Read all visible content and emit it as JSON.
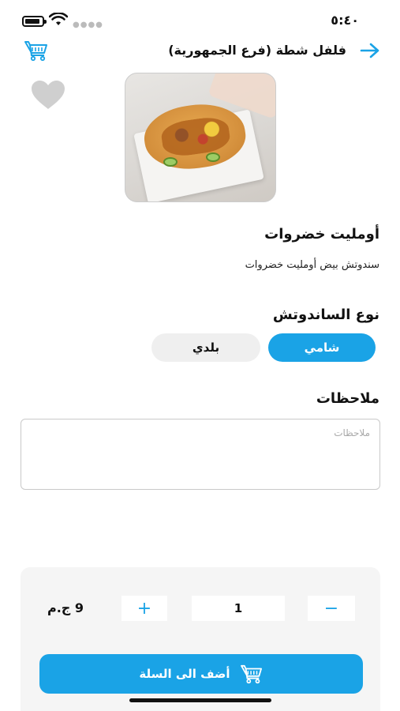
{
  "status_bar": {
    "time": "٥:٤٠"
  },
  "header": {
    "title": "فلفل شطة (فرع الجمهورية)"
  },
  "product": {
    "name": "أومليت خضروات",
    "description": "سندوتش بيض أومليت خضروات"
  },
  "sandwich_type": {
    "title": "نوع الساندوتش",
    "options": [
      {
        "label": "شامي",
        "selected": true
      },
      {
        "label": "بلدي",
        "selected": false
      }
    ]
  },
  "notes": {
    "title": "ملاحظات",
    "placeholder": "ملاحظات",
    "value": ""
  },
  "cart_panel": {
    "price": "9 ج.م",
    "quantity": "1",
    "plus_label": "+",
    "minus_label": "−",
    "add_button_label": "أضف الى السلة"
  },
  "colors": {
    "accent": "#1aa3e6",
    "option_unselected_bg": "#efefef",
    "panel_bg": "#f5f5f5",
    "favorite_icon": "#cfcfcf"
  },
  "icons": {
    "back": "arrow-right-icon",
    "cart_top": "cart-icon",
    "favorite": "heart-icon",
    "add_to_cart": "cart-icon"
  }
}
